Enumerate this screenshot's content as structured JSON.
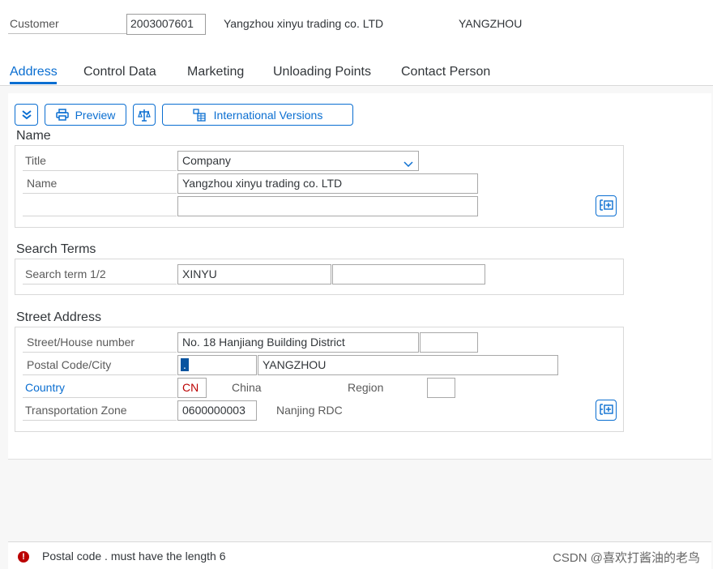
{
  "header": {
    "customer_label": "Customer",
    "customer_number": "2003007601",
    "customer_name": "Yangzhou xinyu trading co. LTD",
    "city": "YANGZHOU"
  },
  "tabs": [
    {
      "label": "Address",
      "active": true
    },
    {
      "label": "Control Data",
      "active": false
    },
    {
      "label": "Marketing",
      "active": false
    },
    {
      "label": "Unloading Points",
      "active": false
    },
    {
      "label": "Contact Person",
      "active": false
    }
  ],
  "toolbar": {
    "preview_label": "Preview",
    "international_label": "International Versions"
  },
  "name_section": {
    "title": "Name",
    "title_label": "Title",
    "title_value": "Company",
    "name_label": "Name",
    "name_value": "Yangzhou xinyu trading co. LTD",
    "name2_value": ""
  },
  "search_section": {
    "title": "Search Terms",
    "label": "Search term 1/2",
    "term1": "XINYU",
    "term2": ""
  },
  "street_section": {
    "title": "Street Address",
    "street_label": "Street/House number",
    "street_value": "No. 18 Hanjiang Building District",
    "house_number": "",
    "postal_label": "Postal Code/City",
    "postal_value": ".",
    "city_value": "YANGZHOU",
    "country_label": "Country",
    "country_code": "CN",
    "country_name": "China",
    "region_label": "Region",
    "region_value": "",
    "transport_label": "Transportation Zone",
    "transport_value": "0600000003",
    "transport_desc": "Nanjing RDC"
  },
  "message": {
    "text": "Postal code . must have the length 6",
    "type": "error",
    "icon": "!"
  },
  "watermark": "CSDN @喜欢打酱油的老鸟",
  "colors": {
    "accent": "#0a6ed1",
    "error": "#bb0000",
    "underline": "#e01010"
  }
}
